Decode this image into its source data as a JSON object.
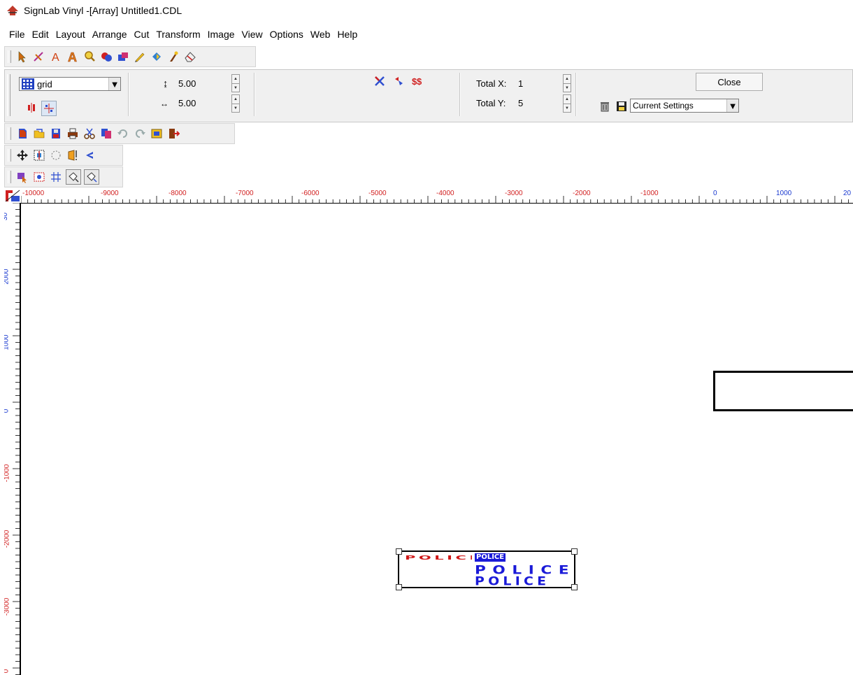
{
  "window": {
    "title": "SignLab Vinyl -[Array] Untitled1.CDL"
  },
  "menu": [
    "File",
    "Edit",
    "Layout",
    "Arrange",
    "Cut",
    "Transform",
    "Image",
    "View",
    "Options",
    "Web",
    "Help"
  ],
  "tools_toolbar": [
    "pointer-tool-icon",
    "node-edit-icon",
    "text-tool-icon",
    "outline-text-icon",
    "zoom-icon",
    "shape-tool-icon",
    "fill-tool-icon",
    "pencil-icon",
    "contour-icon",
    "brush-icon",
    "eraser-icon"
  ],
  "array_bar": {
    "type_value": "grid",
    "spacing_y": "5.00",
    "spacing_x": "5.00",
    "total_x_label": "Total X:",
    "total_x_value": "1",
    "total_y_label": "Total Y:",
    "total_y_value": "5",
    "close_label": "Close",
    "preset_value": "Current Settings"
  },
  "ruler": {
    "h_labels": [
      "-10000",
      "-9000",
      "-8000",
      "-7000",
      "-6000",
      "-5000",
      "-4000",
      "-3000",
      "-2000",
      "-1000",
      "0",
      "1000",
      "20"
    ],
    "v_labels": [
      "30",
      "2000",
      "1000",
      "0",
      "-1000",
      "-2000",
      "-3000",
      "0"
    ]
  },
  "canvas": {
    "police_text": "POLICE"
  },
  "colors": {
    "ruler_negative": "#d22020",
    "ruler_positive": "#1a3ad0",
    "police_blue": "#1a1ad8",
    "police_red": "#d01818"
  }
}
